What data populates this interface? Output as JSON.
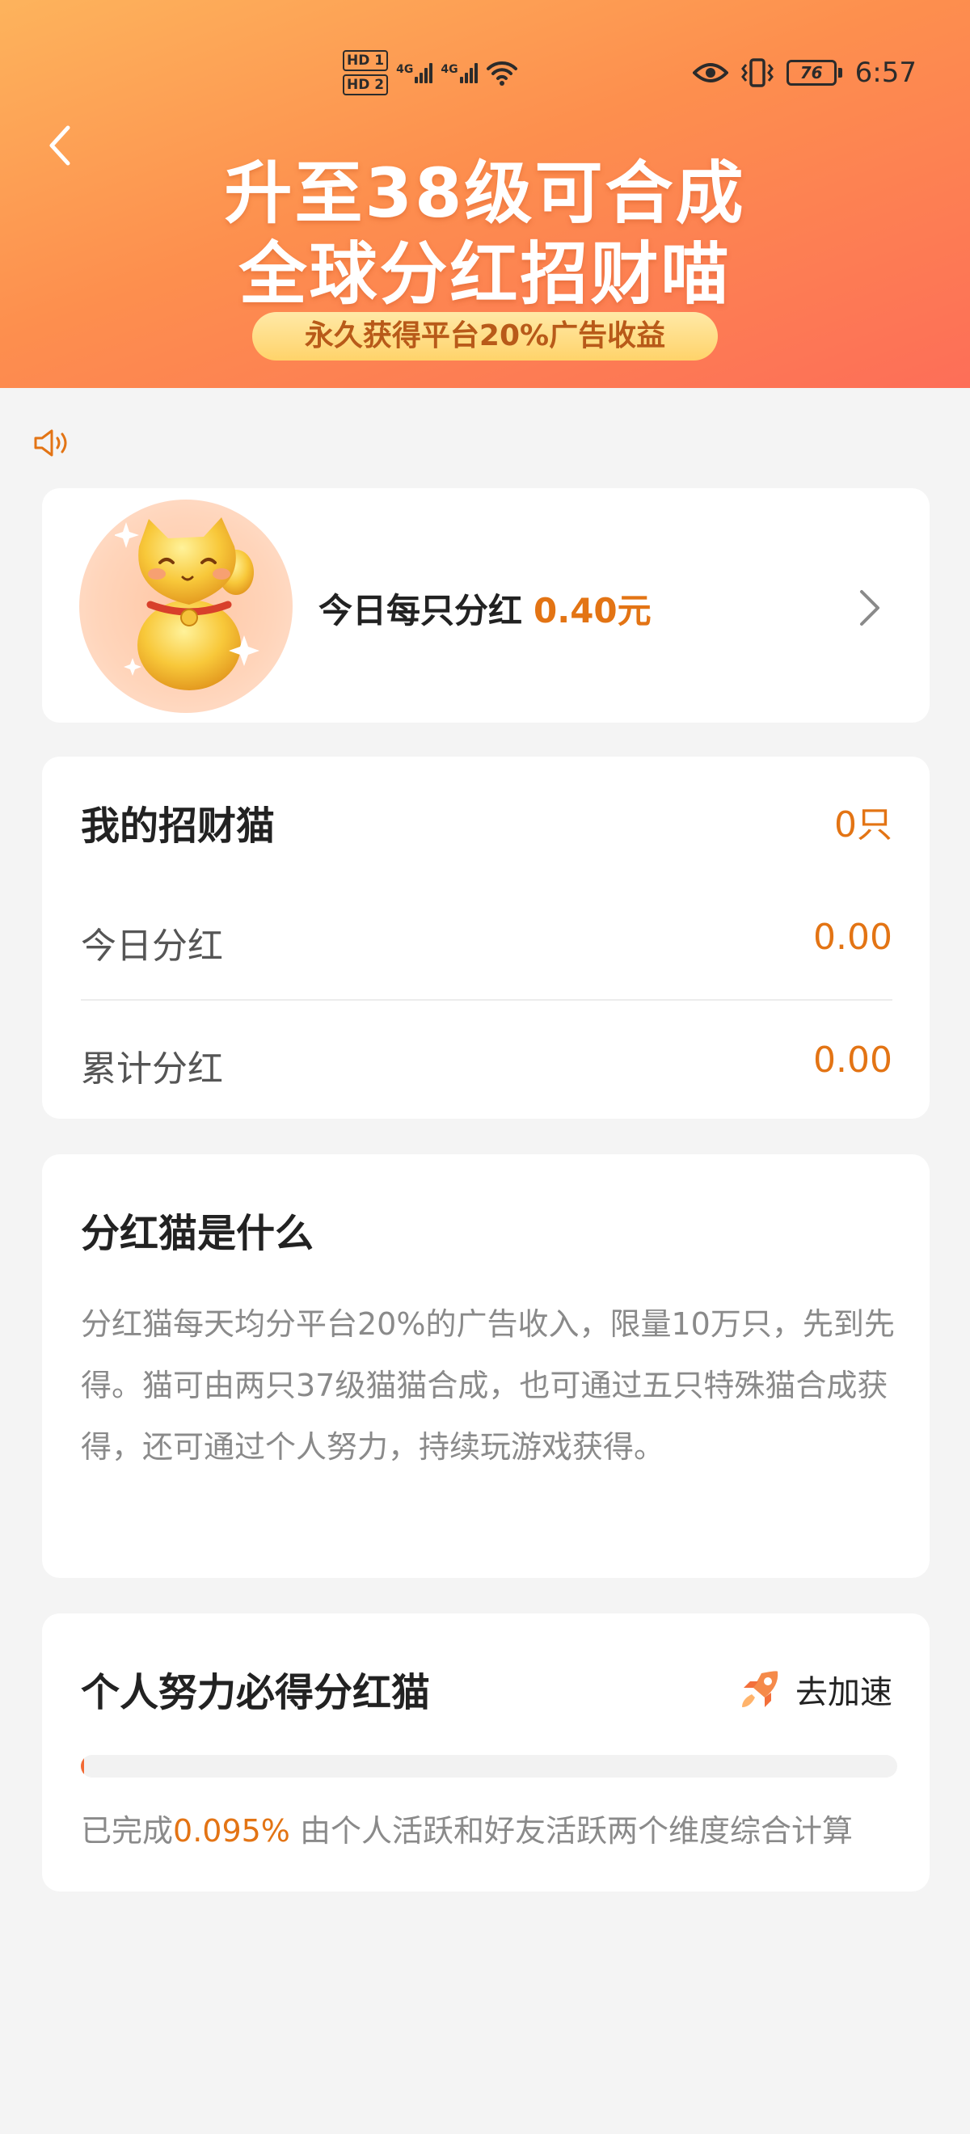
{
  "status_bar": {
    "sim1": "HD 1",
    "sim2": "HD 2",
    "net1": "4G",
    "net2": "4G",
    "battery": "76",
    "time": "6:57"
  },
  "header": {
    "title_line1": "升至38级可合成",
    "title_line2": "全球分红招财喵",
    "badge": "永久获得平台20%广告收益"
  },
  "dividend_card": {
    "label": "今日每只分红",
    "value": "0.40元"
  },
  "my_cats": {
    "title": "我的招财猫",
    "count": "0只",
    "today_label": "今日分红",
    "today_value": "0.00",
    "total_label": "累计分红",
    "total_value": "0.00"
  },
  "about": {
    "title": "分红猫是什么",
    "text": "分红猫每天均分平台20%的广告收入，限量10万只，先到先得。猫可由两只37级猫猫合成，也可通过五只特殊猫合成获得，还可通过个人努力，持续玩游戏获得。"
  },
  "effort": {
    "title": "个人努力必得分红猫",
    "speed_label": "去加速",
    "progress_fraction": 0.00095,
    "progress_prefix": "已完成",
    "progress_percent": "0.095%",
    "progress_suffix": " 由个人活跃和好友活跃两个维度综合计算"
  },
  "colors": {
    "accent": "#e37414",
    "header_start": "#fdb35c",
    "header_end": "#fd6e58",
    "progress": "#f26a35"
  },
  "icons": {
    "back": "chevron-left-icon",
    "speaker": "speaker-icon",
    "cat": "lucky-cat-icon",
    "arrow": "chevron-right-icon",
    "rocket": "rocket-icon"
  }
}
